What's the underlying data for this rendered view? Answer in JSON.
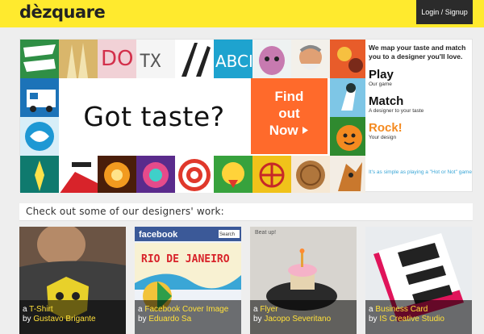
{
  "header": {
    "logo": "dèzquare",
    "login_label": "Login / Signup"
  },
  "hero": {
    "headline": "Got taste?",
    "cta_line1": "Find",
    "cta_line2": "out",
    "cta_line3": "Now",
    "intro": "We map your taste and match you to a designer you'll love.",
    "steps": [
      {
        "title": "Play",
        "sub": "Our game"
      },
      {
        "title": "Match",
        "sub": "A designer to your taste"
      },
      {
        "title": "Rock!",
        "sub": "Your design"
      }
    ],
    "footer_note": "It's as simple as playing a \"Hot or Not\" game"
  },
  "section": {
    "title": "Check out some of our designers' work:"
  },
  "cards": [
    {
      "type_prefix": "a",
      "type": "T-Shirt",
      "by_prefix": "by",
      "designer": "Gustavo Brigante"
    },
    {
      "type_prefix": "a",
      "type": "Facebook Cover Image",
      "by_prefix": "by",
      "designer": "Eduardo Sa"
    },
    {
      "type_prefix": "a",
      "type": "Flyer",
      "by_prefix": "by",
      "designer": "Jacopo Severitano"
    },
    {
      "type_prefix": "a",
      "type": "Business Card",
      "by_prefix": "by",
      "designer": "IS Creative Studio"
    }
  ],
  "card_art": {
    "facebook_word": "facebook",
    "fb_search": "Search",
    "rio": "RIO DE JANEIRO",
    "flyer_top": "Beat up!"
  },
  "colors": {
    "brand_yellow": "#ffea2e",
    "cta_orange": "#ff6a2b",
    "accent_blue": "#3aa6d6",
    "caption_yellow": "#ffe03a"
  }
}
